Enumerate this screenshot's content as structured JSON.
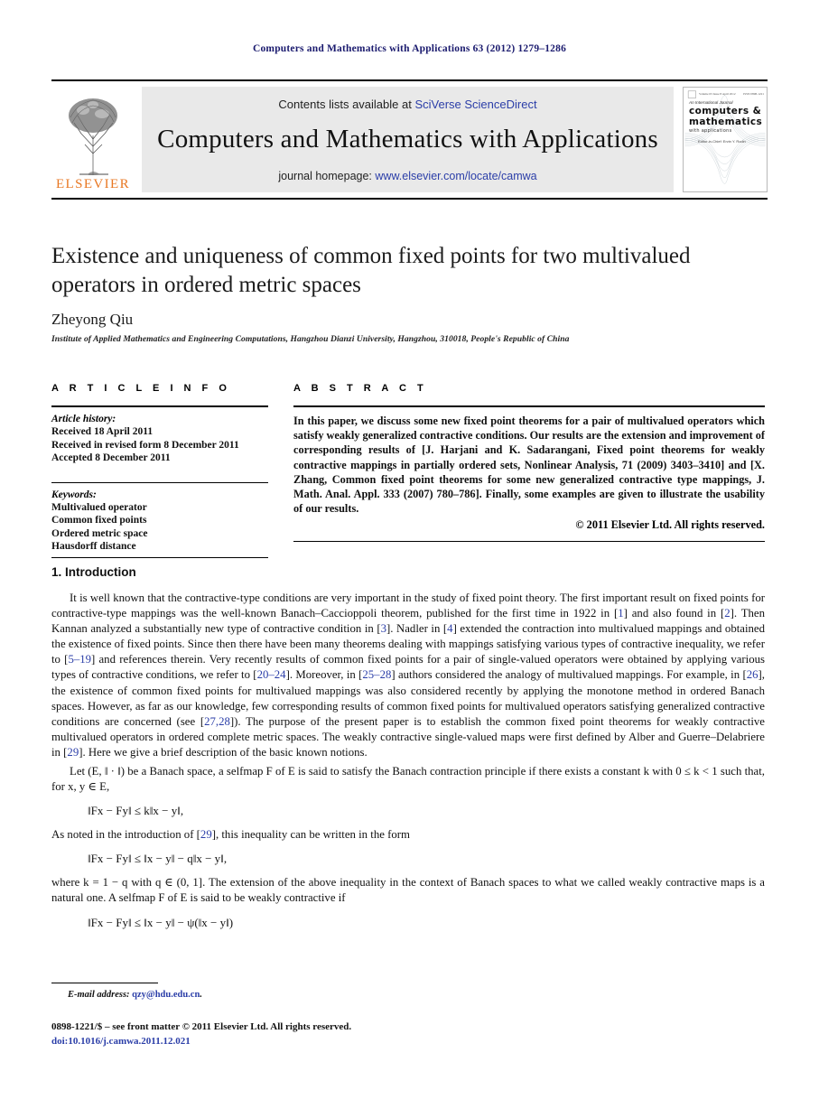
{
  "running_head": "Computers and Mathematics with Applications 63 (2012) 1279–1286",
  "masthead": {
    "publisher_name": "ELSEVIER",
    "contents_prefix": "Contents lists available at ",
    "contents_link": "SciVerse ScienceDirect",
    "journal_title": "Computers and Mathematics with Applications",
    "homepage_prefix": "journal homepage: ",
    "homepage_url": "www.elsevier.com/locate/camwa",
    "cover": {
      "top_left": "Volume 63 Issue 8 April 2012",
      "top_right": "ISSN 0898-1221",
      "line1": "An International Journal",
      "line2": "computers &",
      "line3": "mathematics",
      "line4": "with applications",
      "editors": "Editor-in-Chief: Ervin Y. Rodin"
    }
  },
  "article": {
    "title": "Existence and uniqueness of common fixed points for two multivalued operators in ordered metric spaces",
    "author": "Zheyong Qiu",
    "affiliation": "Institute of Applied Mathematics and Engineering Computations, Hangzhou Dianzi University, Hangzhou, 310018, People's Republic of China"
  },
  "info": {
    "heading": "A R T I C L E   I N F O",
    "history_label": "Article history:",
    "history": [
      "Received 18 April 2011",
      "Received in revised form 8 December 2011",
      "Accepted 8 December 2011"
    ],
    "keywords_label": "Keywords:",
    "keywords": [
      "Multivalued operator",
      "Common fixed points",
      "Ordered metric space",
      "Hausdorff distance"
    ]
  },
  "abstract": {
    "heading": "A B S T R A C T",
    "text": "In this paper, we discuss some new fixed point theorems for a pair of multivalued operators which satisfy weakly generalized contractive conditions. Our results are the extension and improvement of corresponding results of [J. Harjani and K. Sadarangani, Fixed point theorems for weakly contractive mappings in partially ordered sets, Nonlinear Analysis, 71 (2009) 3403–3410] and [X. Zhang, Common fixed point theorems for some new generalized contractive type mappings, J. Math. Anal. Appl. 333 (2007) 780–786]. Finally, some examples are given to illustrate the usability of our results.",
    "copyright": "© 2011 Elsevier Ltd. All rights reserved."
  },
  "body": {
    "section_title": "1. Introduction",
    "para1_a": "It is well known that the contractive-type conditions are very important in the study of fixed point theory. The first important result on fixed points for contractive-type mappings was the well-known Banach–Caccioppoli theorem, published for the first time in 1922 in [",
    "ref1": "1",
    "para1_b": "] and also found in [",
    "ref2": "2",
    "para1_c": "]. Then Kannan analyzed a substantially new type of contractive condition in [",
    "ref3": "3",
    "para1_d": "]. Nadler in [",
    "ref4": "4",
    "para1_e": "] extended the contraction into multivalued mappings and obtained the existence of fixed points. Since then there have been many theorems dealing with mappings satisfying various types of contractive inequality, we refer to [",
    "ref5": "5–19",
    "para1_f": "] and references therein. Very recently results of common fixed points for a pair of single-valued operators were obtained by applying various types of contractive conditions, we refer to [",
    "ref6": "20–24",
    "para1_g": "]. Moreover, in [",
    "ref7": "25–28",
    "para1_h": "] authors considered the analogy of multivalued mappings. For example, in [",
    "ref8": "26",
    "para1_i": "], the existence of common fixed points for multivalued mappings was also considered recently by applying the monotone method in ordered Banach spaces. However, as far as our knowledge, few corresponding results of common fixed points for multivalued operators satisfying generalized contractive conditions are concerned (see [",
    "ref9": "27,28",
    "para1_j": "]). The purpose of the present paper is to establish the common fixed point theorems for weakly contractive multivalued operators in ordered complete metric spaces. The weakly contractive single-valued maps were first defined by Alber and Guerre–Delabriere in [",
    "ref10": "29",
    "para1_k": "]. Here we give a brief description of the basic known notions.",
    "para2_a": "Let (E, ‖ · ‖) be a Banach space, a selfmap F of E is said to satisfy the Banach contraction principle if there exists a constant k with 0 ≤ k < 1 such that, for x, y ∈ E,",
    "eq1": "‖Fx − Fy‖ ≤ k‖x − y‖,",
    "para3_a": "As noted in the introduction of [",
    "ref11": "29",
    "para3_b": "], this inequality can be written in the form",
    "eq2": "‖Fx − Fy‖ ≤ ‖x − y‖ − q‖x − y‖,",
    "para4_a": "where k = 1 − q with q ∈ (0, 1]. The extension of the above inequality in the context of Banach spaces to what we called weakly contractive maps is a natural one. A selfmap F of E is said to be weakly contractive if",
    "eq3": "‖Fx − Fy‖ ≤ ‖x − y‖ − ψ(‖x − y‖)"
  },
  "footer": {
    "email_label": "E-mail address:",
    "email": "qzy@hdu.edu.cn",
    "email_suffix": ".",
    "issn": "0898-1221/$ – see front matter © 2011 Elsevier Ltd. All rights reserved.",
    "doi": "doi:10.1016/j.camwa.2011.12.021"
  },
  "colors": {
    "link": "#2b3ea8",
    "running_head": "#1a1a6e",
    "elsevier_orange": "#E87722",
    "band_bg": "#e9e9e9"
  }
}
